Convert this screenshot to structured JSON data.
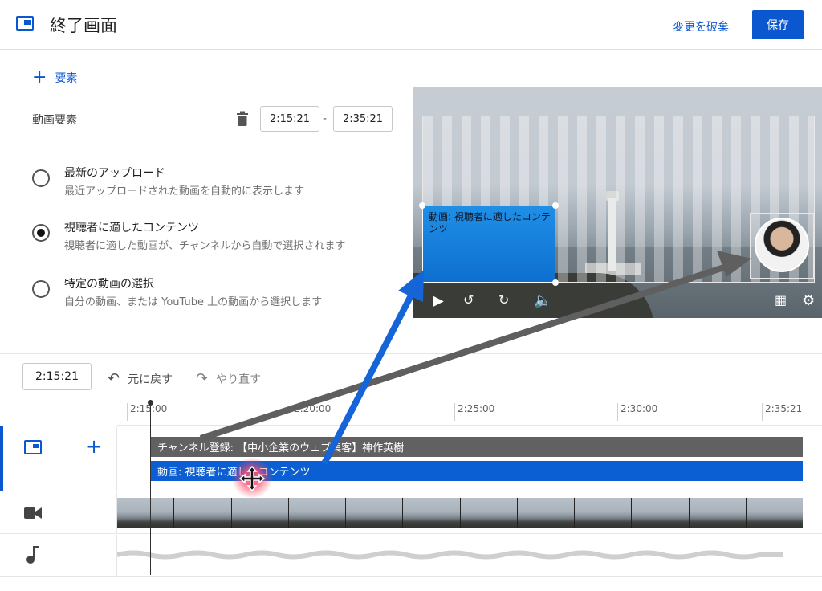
{
  "header": {
    "title": "終了画面",
    "discard_label": "変更を破棄",
    "save_label": "保存"
  },
  "editor": {
    "add_element_label": "要素",
    "element_label": "動画要素",
    "start_time": "2:15:21",
    "end_time": "2:35:21",
    "time_separator": "-",
    "options": [
      {
        "title": "最新のアップロード",
        "description": "最近アップロードされた動画を自動的に表示します",
        "selected": false
      },
      {
        "title": "視聴者に適したコンテンツ",
        "description": "視聴者に適した動画が、チャンネルから自動で選択されます",
        "selected": true
      },
      {
        "title": "特定の動画の選択",
        "description": "自分の動画、または YouTube 上の動画から選択します",
        "selected": false
      }
    ]
  },
  "preview": {
    "video_element_text": "動画: 視聴者に適したコンテンツ"
  },
  "toolbar": {
    "current_time": "2:15:21",
    "undo_label": "元に戻す",
    "redo_label": "やり直す"
  },
  "timeline": {
    "ticks": [
      "2:15:00",
      "2:20:00",
      "2:25:00",
      "2:30:00",
      "2:35:21"
    ],
    "subscribe_clip": "チャンネル登録: 【中小企業のウェブ集客】神作英樹",
    "video_clip": "動画: 視聴者に適したコンテンツ"
  },
  "colors": {
    "accent": "#0b57d0",
    "arrow_blue": "#1565d8",
    "arrow_gray": "#5f5f5f"
  }
}
